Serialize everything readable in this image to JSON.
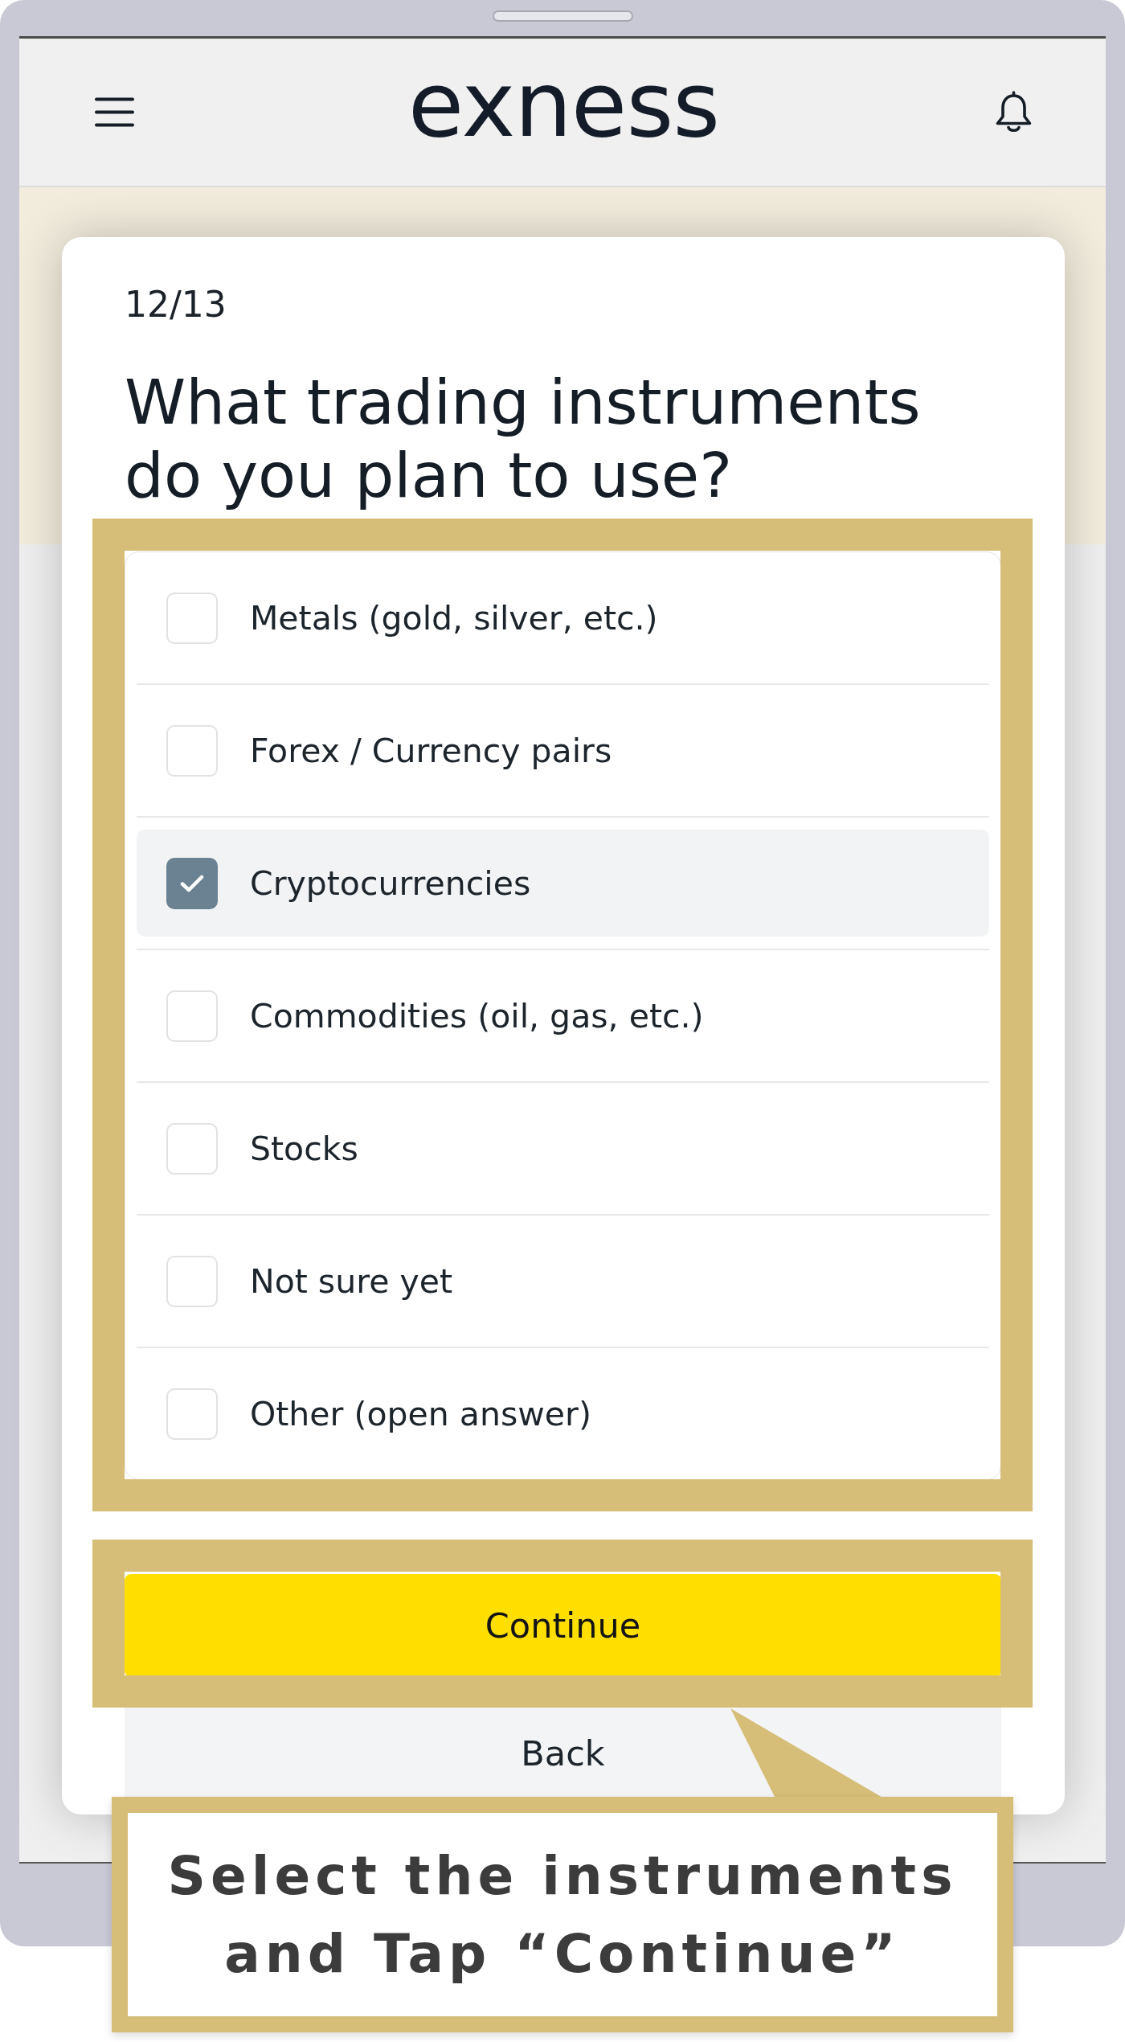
{
  "header": {
    "logo": "exness"
  },
  "modal": {
    "step": "12/13",
    "question": "What trading instruments do you plan to use?",
    "options": [
      {
        "label": "Metals (gold, silver, etc.)",
        "checked": false
      },
      {
        "label": "Forex / Currency pairs",
        "checked": false
      },
      {
        "label": "Cryptocurrencies",
        "checked": true
      },
      {
        "label": "Commodities (oil, gas, etc.)",
        "checked": false
      },
      {
        "label": "Stocks",
        "checked": false
      },
      {
        "label": "Not sure yet",
        "checked": false
      },
      {
        "label": "Other (open answer)",
        "checked": false
      }
    ],
    "buttons": [
      {
        "label": "Continue",
        "kind": "primary"
      },
      {
        "label": "Back",
        "kind": "secondary"
      }
    ]
  },
  "annotation": {
    "callout": "Select the instruments and Tap “Continue”"
  }
}
